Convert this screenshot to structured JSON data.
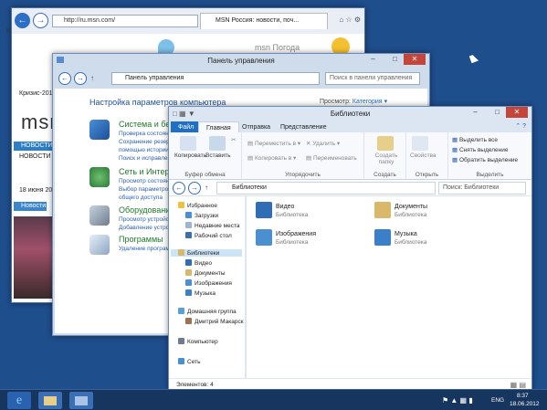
{
  "ie": {
    "url": "http://ru.msn.com/",
    "tab_title": "MSN Россия: новости, поч...",
    "logo_text": "msn",
    "msn_pogoda": "Погода",
    "krizis": "Кризис-2011",
    "novosti1": "НОВОСТИ",
    "novosti2": "НОВОСТИ",
    "date": "18 июня 2012",
    "novosti_btn": "Новости",
    "left_k": "К"
  },
  "control_panel": {
    "title": "Панель управления",
    "path": "Панель управления",
    "search_placeholder": "Поиск в панели управления",
    "heading": "Настройка параметров компьютера",
    "view_label": "Просмотр:",
    "view_value": "Категория",
    "categories": [
      {
        "title": "Система и безо",
        "links": [
          "Проверка состоян",
          "Сохранение резер",
          "помощью истории",
          "Поиск и исправлен"
        ]
      },
      {
        "title": "Сеть и Интерн",
        "links": [
          "Просмотр состоян",
          "Выбор параметро",
          "общего доступа"
        ]
      },
      {
        "title": "Оборудование",
        "links": [
          "Просмотр устройс",
          "Добавление устро"
        ]
      },
      {
        "title": "Программы",
        "links": [
          "Удаление програм"
        ]
      }
    ]
  },
  "libraries": {
    "title": "Библиотеки",
    "tabs": [
      "Файл",
      "Главная",
      "Отправка",
      "Представление"
    ],
    "ribbon": {
      "copy": "Копировать",
      "paste": "Вставить",
      "clipboard_group": "Буфер обмена",
      "move_to": "Переместить в",
      "copy_to": "Копировать в",
      "delete": "Удалить",
      "rename": "Переименовать",
      "organize_group": "Упорядочить",
      "new_folder": "Создать папку",
      "create_group": "Создать",
      "properties": "Свойства",
      "open_group": "Открыть",
      "select_all": "Выделить все",
      "select_none": "Снять выделение",
      "invert_selection": "Обратить выделение",
      "select_group": "Выделить"
    },
    "path": "Библиотеки",
    "search_placeholder": "Поиск: Библиотеки",
    "nav": {
      "favorites": "Избранное",
      "downloads": "Загрузки",
      "recent": "Недавние места",
      "desktop": "Рабочий стол",
      "libraries": "Библиотеки",
      "video": "Видео",
      "documents": "Документы",
      "images": "Изображения",
      "music": "Музыка",
      "homegroup": "Домашняя группа",
      "user": "Дмитрий Макарск",
      "computer": "Компьютер",
      "network": "Сеть"
    },
    "items": [
      {
        "name": "Видео",
        "desc": "Библиотека",
        "color": "#2f6db5"
      },
      {
        "name": "Документы",
        "desc": "Библиотека",
        "color": "#d9b86a"
      },
      {
        "name": "Изображения",
        "desc": "Библиотека",
        "color": "#4a8fd0"
      },
      {
        "name": "Музыка",
        "desc": "Библиотека",
        "color": "#3a7fc8"
      }
    ],
    "status": "Элементов: 4"
  },
  "taskbar": {
    "lang": "ENG",
    "time": "8:37",
    "date": "18.06.2012"
  }
}
